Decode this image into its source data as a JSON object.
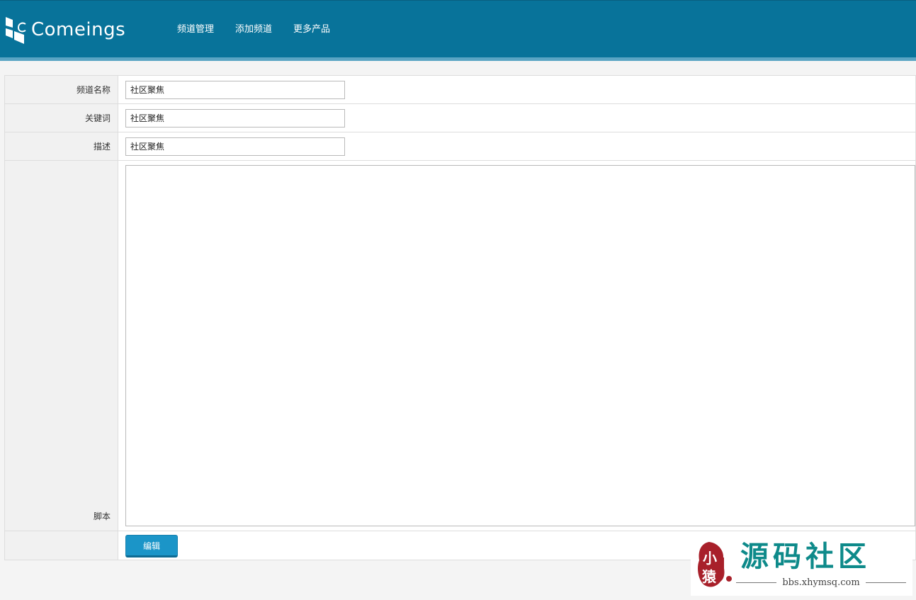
{
  "header": {
    "logo_text": "Comeings",
    "nav": [
      {
        "label": "频道管理"
      },
      {
        "label": "添加频道"
      },
      {
        "label": "更多产品"
      }
    ],
    "colors": {
      "bar": "#08739a",
      "strip": "#5aa5c4"
    }
  },
  "form": {
    "channel_name": {
      "label": "频道名称",
      "value": "社区聚焦"
    },
    "keywords": {
      "label": "关键词",
      "value": "社区聚焦"
    },
    "description": {
      "label": "描述",
      "value": "社区聚焦"
    },
    "script": {
      "label": "脚本",
      "value": ""
    },
    "submit_label": "编辑"
  },
  "watermark": {
    "title": "源码社区",
    "url": "bbs.xhymsq.com",
    "seal_text": "小猿"
  }
}
